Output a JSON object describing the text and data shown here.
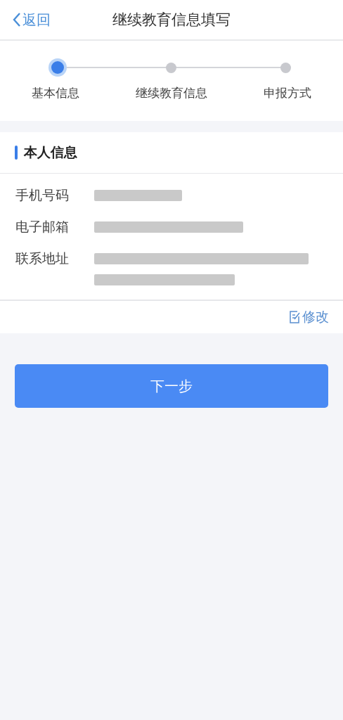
{
  "header": {
    "back_label": "返回",
    "title": "继续教育信息填写"
  },
  "steps": [
    {
      "label": "基本信息",
      "selected": true
    },
    {
      "label": "继续教育信息",
      "selected": false
    },
    {
      "label": "申报方式",
      "selected": false
    }
  ],
  "section": {
    "title": "本人信息",
    "fields": [
      {
        "label": "手机号码",
        "redacted": [
          true
        ]
      },
      {
        "label": "电子邮箱",
        "redacted": [
          true
        ]
      },
      {
        "label": "联系地址",
        "redacted": [
          true,
          true
        ]
      }
    ],
    "edit_label": "修改"
  },
  "next_button": "下一步"
}
